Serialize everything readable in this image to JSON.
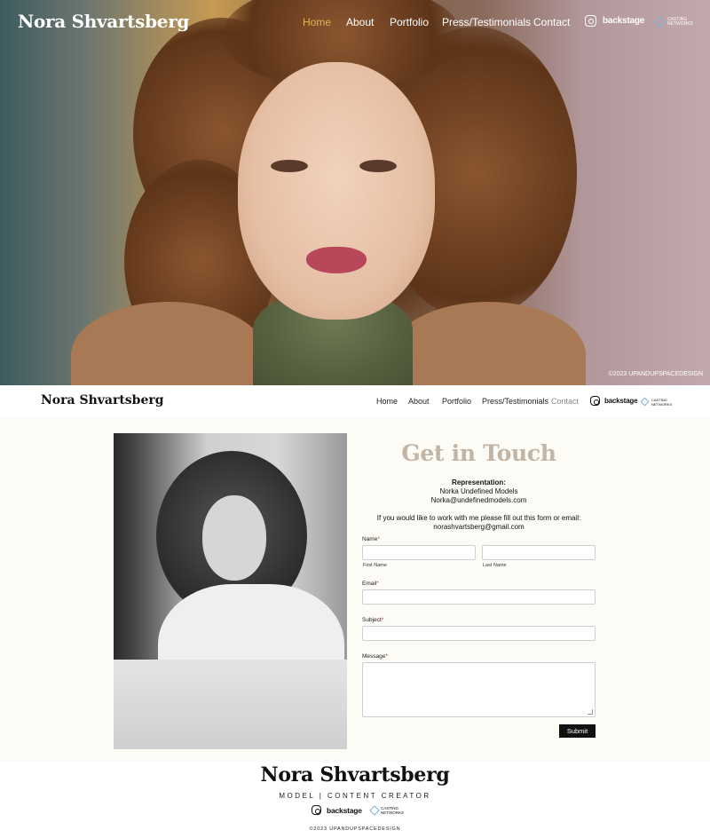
{
  "site": {
    "brand": "Nora Shvartsberg",
    "hero_copyright": "©2023 UPANDUPSPACEDESIGN"
  },
  "nav": {
    "items": [
      {
        "label": "Home",
        "active": true
      },
      {
        "label": "About",
        "active": false
      },
      {
        "label": "Portfolio",
        "active": false
      },
      {
        "label": "Press/Testimonials",
        "active": false
      },
      {
        "label": "Contact",
        "active": false
      }
    ],
    "social": {
      "instagram": "instagram-icon",
      "backstage": "backstage",
      "casting_line1": "CASTING",
      "casting_line2": "NETWORKS"
    }
  },
  "nav2": {
    "brand": "Nora Shvartsberg",
    "items": [
      {
        "label": "Home"
      },
      {
        "label": "About"
      },
      {
        "label": "Portfolio"
      },
      {
        "label": "Press/Testimonials"
      },
      {
        "label": "Contact",
        "current": true
      }
    ]
  },
  "contact": {
    "heading": "Get in Touch",
    "rep_title": "Representation:",
    "rep_agency": "Norka Undefined Models",
    "rep_email": "Norka@undefinedmodels.com",
    "intro": "If you would like to work with me please fill out this form or email:",
    "email": "norashvartsberg@gmail.com",
    "form": {
      "name_label": "Name",
      "first_name_sub": "First Name",
      "last_name_sub": "Last Name",
      "email_label": "Email",
      "subject_label": "Subject",
      "message_label": "Message",
      "required_mark": "*",
      "first_name_value": "",
      "last_name_value": "",
      "email_value": "",
      "subject_value": "",
      "message_value": "",
      "submit_label": "Submit"
    }
  },
  "footer": {
    "brand": "Nora Shvartsberg",
    "tagline": "MODEL | CONTENT CREATOR",
    "copyright": "©2023 UPANDUPSPACEDESIGN"
  },
  "colors": {
    "accent_active": "#e0b650",
    "heading": "#c3b4a3",
    "section_bg": "#fdfbf6",
    "button": "#111111"
  }
}
